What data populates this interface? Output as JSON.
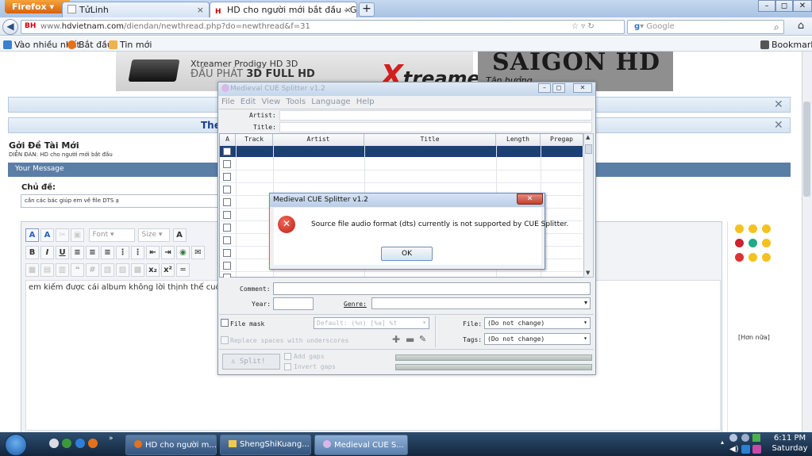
{
  "browser": {
    "firefox_label": "Firefox",
    "tabs": [
      {
        "label": "TửLinh"
      },
      {
        "label": "HD cho người mới bắt đầu - Gởi Đề ..."
      }
    ],
    "url_prefix": "www.",
    "url_host": "hdvietnam.com",
    "url_path": "/diendan/newthread.php?do=newthread&f=31",
    "search_placeholder": "Google",
    "bookmarks": [
      "Vào nhiều nhất",
      "Bắt đầu",
      "Tin mới"
    ],
    "bookmarks_right": "Bookmarks"
  },
  "page": {
    "banner_left": {
      "title": "Xtreamer Prodigy HD 3D",
      "subtitle_pre": "ĐẦU PHÁT ",
      "subtitle_bold": "3D FULL HD",
      "logo": "treamer",
      "logo_x": "X"
    },
    "banner_right": {
      "title": "SAIGON HD",
      "subtitle": "Tận hưởng"
    },
    "heading_fragment": "The",
    "new_thread_title": "Gởi Đề Tài Mới",
    "breadcrumb": "DIỄN ĐÀN: HD cho người mới bắt đầu",
    "message_bar": "Your Message",
    "subject_label": "Chủ đề:",
    "subject_value": "cần các bác giúp em về file DTS ạ",
    "font_placeholder": "Font",
    "size_placeholder": "Size",
    "editor_text": "em kiếm được cái album không lời thịnh thế cuồ",
    "more_smilies": "[Hơn nữa]"
  },
  "cue": {
    "title": "Medieval CUE Splitter v1.2",
    "menu": [
      "File",
      "Edit",
      "View",
      "Tools",
      "Language",
      "Help"
    ],
    "artist_label": "Artist:",
    "title_label": "Title:",
    "columns": [
      "A",
      "Track",
      "Artist",
      "Title",
      "Length",
      "Pregap"
    ],
    "comment_label": "Comment:",
    "year_label": "Year:",
    "genre_label": "Genre:",
    "file_mask_label": "File mask",
    "file_mask_value": "Default: (%n) [%a] %t",
    "replace_label": "Replace spaces with underscores",
    "file_label": "File:",
    "file_value": "(Do not change)",
    "tags_label": "Tags:",
    "tags_value": "(Do not change)",
    "split_label": "Split!",
    "add_gaps": "Add gaps",
    "invert_gaps": "Invert gaps"
  },
  "dialog": {
    "title": "Medieval CUE Splitter v1.2",
    "message": "Source file audio format (dts) currently is not supported by CUE Splitter.",
    "ok": "OK"
  },
  "taskbar": {
    "tasks": [
      "HD cho người m...",
      "ShengShiKuang...",
      "Medieval CUE S..."
    ],
    "time": "6:11 PM",
    "day": "Saturday"
  },
  "colors": {
    "accent": "#1c3f75",
    "message_bar": "#5b7ea6",
    "firefox": "#e4711b",
    "error": "#c0251a"
  }
}
